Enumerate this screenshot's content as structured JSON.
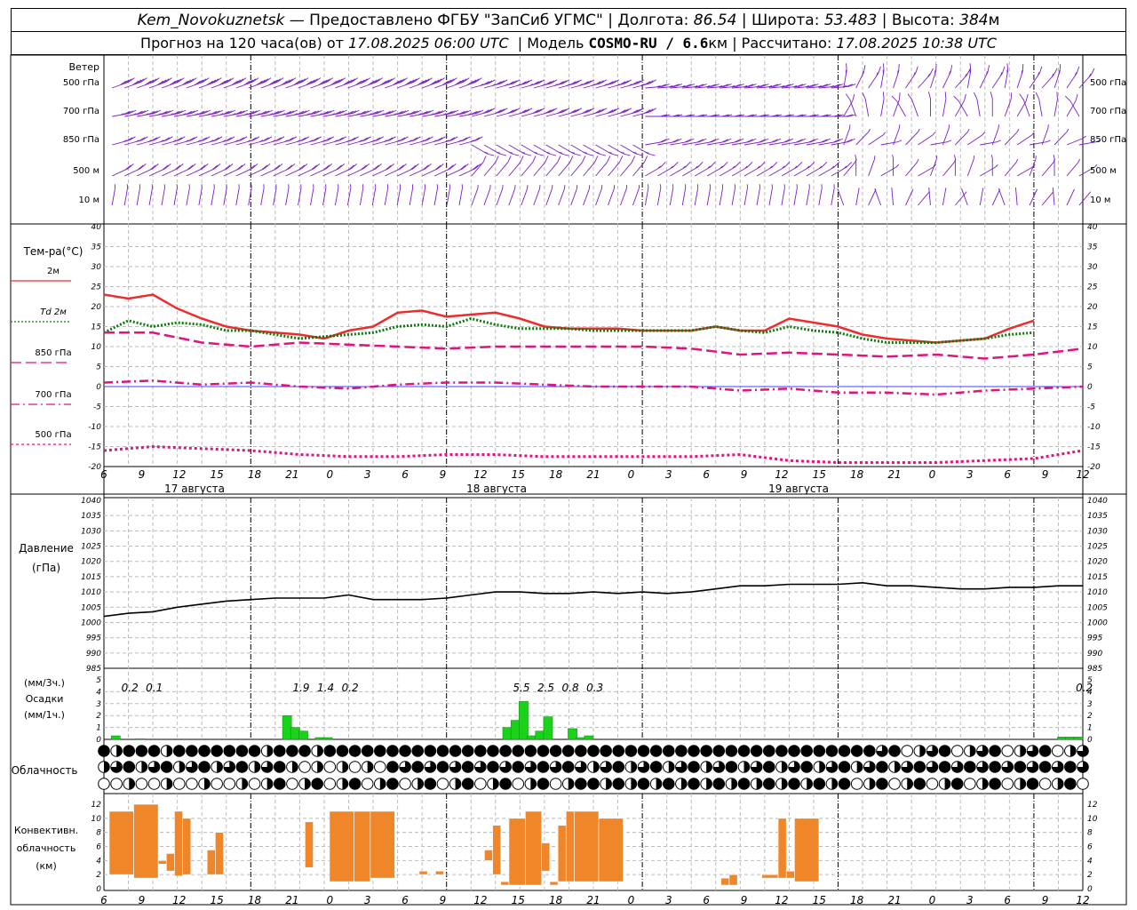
{
  "header": {
    "station": "Kem_Novokuznetsk",
    "provider": " — Предоставлено ФГБУ \"ЗапСиб УГМС\" | ",
    "lon_label": "Долгота: ",
    "lon_value": "86.54",
    "lat_label": " | Широта: ",
    "lat_value": "53.483",
    "alt_label": " | Высота: ",
    "alt_value": "384",
    "alt_unit": "м",
    "forecast_prefix": "Прогноз на 120 часа(ов) от ",
    "forecast_time": "17.08.2025 06:00 UTC",
    "model_label": "  | Модель ",
    "model_name": "COSMO-RU / 6.6",
    "model_unit": "км",
    "calc_label": " | Рассчитано: ",
    "calc_time": "17.08.2025 10:38 UTC"
  },
  "wind_panel": {
    "title": "Ветер",
    "levels": [
      "500 гПа",
      "700 гПа",
      "850 гПа",
      "500  м",
      "10   м"
    ]
  },
  "temp_panel": {
    "title": "Тем-ра(°C)",
    "legend": [
      {
        "label": "2м",
        "color": "#ee2c2c",
        "style": "solid"
      },
      {
        "label": "Td  2м",
        "color": "#0a7a0a",
        "style": "dotted"
      },
      {
        "label": "850 гПа",
        "color": "#e0147c",
        "style": "dashed"
      },
      {
        "label": "700 гПа",
        "color": "#e0147c",
        "style": "dashdot"
      },
      {
        "label": "500 гПа",
        "color": "#e0147c",
        "style": "dots"
      }
    ],
    "y_ticks": [
      "40",
      "35",
      "30",
      "25",
      "20",
      "15",
      "10",
      "5",
      "0",
      "-5",
      "-10",
      "-15",
      "-20"
    ]
  },
  "x_axis": {
    "hour_labels": [
      "6",
      "9",
      "12",
      "15",
      "18",
      "21",
      "0",
      "3",
      "6",
      "9",
      "12",
      "15",
      "18",
      "21",
      "0",
      "3",
      "6",
      "9",
      "12",
      "15",
      "18",
      "21",
      "0",
      "3",
      "6",
      "9",
      "12"
    ],
    "dates": [
      "17 августа",
      "18 августа",
      "19 августа"
    ]
  },
  "pressure_panel": {
    "title": "Давление",
    "unit": "(гПа)",
    "y_ticks": [
      "1040",
      "1035",
      "1030",
      "1025",
      "1020",
      "1015",
      "1010",
      "1005",
      "1000",
      "995",
      "990",
      "985"
    ]
  },
  "precip_panel": {
    "unit3": "(мм/3ч.)",
    "title": "Осадки",
    "unit1": "(мм/1ч.)",
    "y_ticks": [
      "5",
      "4",
      "3",
      "2",
      "1",
      "0"
    ],
    "totals": [
      {
        "x": 1,
        "text": "0.2"
      },
      {
        "x": 4,
        "text": "0.1"
      },
      {
        "x": 22,
        "text": "1.9"
      },
      {
        "x": 25,
        "text": "1.4"
      },
      {
        "x": 28,
        "text": "0.2"
      },
      {
        "x": 49,
        "text": "5.5"
      },
      {
        "x": 52,
        "text": "2.5"
      },
      {
        "x": 55,
        "text": "0.8"
      },
      {
        "x": 58,
        "text": "0.3"
      },
      {
        "x": 118,
        "text": "0.2"
      }
    ]
  },
  "cloud_panel": {
    "title": "Облачность"
  },
  "conv_panel": {
    "title1": "Конвективн.",
    "title2": "облачность",
    "unit": "(км)",
    "y_ticks": [
      "12",
      "10",
      "8",
      "6",
      "4",
      "2",
      "0"
    ]
  },
  "chart_data": {
    "type": "line",
    "x_hours_start": "2025-08-17 06:00 UTC",
    "x_step_hours": 1,
    "temperature": {
      "ylim": [
        -20,
        40
      ],
      "series": [
        {
          "name": "2м",
          "x": [
            0,
            3,
            6,
            9,
            12,
            15,
            18,
            21,
            24,
            27,
            30,
            33,
            36,
            39,
            42,
            45,
            48,
            51,
            54,
            57,
            60,
            63,
            66,
            69,
            72,
            75,
            78,
            81,
            84,
            87,
            90,
            93,
            96,
            99,
            102,
            105,
            108,
            111,
            114
          ],
          "values": [
            23,
            22,
            23,
            19.5,
            17,
            15,
            14,
            13.5,
            13,
            12,
            14,
            15,
            18.5,
            19,
            17.5,
            18,
            18.5,
            17,
            15,
            14.5,
            14.5,
            14.5,
            14,
            14,
            14,
            15,
            14,
            14,
            17,
            16,
            15,
            13,
            12,
            11.5,
            11,
            11.5,
            12,
            14.5,
            16.5
          ]
        },
        {
          "name": "Td  2м",
          "x": [
            0,
            3,
            6,
            9,
            12,
            15,
            18,
            21,
            24,
            27,
            30,
            33,
            36,
            39,
            42,
            45,
            48,
            51,
            54,
            57,
            60,
            63,
            66,
            69,
            72,
            75,
            78,
            81,
            84,
            87,
            90,
            93,
            96,
            99,
            102,
            105,
            108,
            111,
            114
          ],
          "values": [
            13.5,
            16.5,
            15,
            16,
            15.5,
            14,
            14,
            13,
            12,
            12.5,
            13,
            13.5,
            15,
            15.5,
            15,
            17,
            15.5,
            14.5,
            14.5,
            14.5,
            14,
            14,
            14,
            14,
            14,
            15,
            14,
            13.5,
            15,
            14,
            13.5,
            12,
            11,
            11,
            11,
            11.5,
            12,
            13,
            13.5
          ]
        },
        {
          "name": "850 гПа",
          "x": [
            0,
            6,
            12,
            18,
            24,
            30,
            36,
            42,
            48,
            54,
            60,
            66,
            72,
            78,
            84,
            90,
            96,
            102,
            108,
            114,
            120
          ],
          "values": [
            13.5,
            13.5,
            11,
            10,
            11,
            10.5,
            10,
            9.5,
            10,
            10,
            10,
            10,
            9.5,
            8,
            8.5,
            8,
            7.5,
            8,
            7,
            8,
            9.5
          ]
        },
        {
          "name": "700 гПа",
          "x": [
            0,
            6,
            12,
            18,
            24,
            30,
            36,
            42,
            48,
            54,
            60,
            66,
            72,
            78,
            84,
            90,
            96,
            102,
            108,
            114,
            120
          ],
          "values": [
            1,
            1.5,
            0.5,
            1,
            0,
            -0.5,
            0.5,
            1,
            1,
            0.5,
            0,
            0,
            0,
            -1,
            -0.5,
            -1.5,
            -1.5,
            -2,
            -1,
            -0.5,
            0
          ]
        },
        {
          "name": "500 гПа",
          "x": [
            0,
            6,
            12,
            18,
            24,
            30,
            36,
            42,
            48,
            54,
            60,
            66,
            72,
            78,
            84,
            90,
            96,
            102,
            108,
            114,
            120
          ],
          "values": [
            -16,
            -15,
            -15.5,
            -16,
            -17,
            -17.5,
            -17.5,
            -17,
            -17,
            -17.5,
            -17.5,
            -17.5,
            -17.5,
            -17,
            -18.5,
            -19,
            -19,
            -19,
            -18.5,
            -18,
            -16
          ]
        }
      ]
    },
    "pressure": {
      "ylim": [
        985,
        1040
      ],
      "x": [
        0,
        3,
        6,
        9,
        12,
        15,
        18,
        21,
        24,
        27,
        30,
        33,
        36,
        39,
        42,
        45,
        48,
        51,
        54,
        57,
        60,
        63,
        66,
        69,
        72,
        75,
        78,
        81,
        84,
        87,
        90,
        93,
        96,
        99,
        102,
        105,
        108,
        111,
        114,
        117,
        120
      ],
      "values": [
        1002,
        1003,
        1003.5,
        1005,
        1006,
        1007,
        1007.5,
        1008,
        1008,
        1008,
        1009,
        1007.5,
        1007.5,
        1007.5,
        1008,
        1009,
        1010,
        1010,
        1009.5,
        1009.5,
        1010,
        1009.5,
        1010,
        1009.5,
        1010,
        1011,
        1012,
        1012,
        1012.5,
        1012.5,
        1012.5,
        1013,
        1012,
        1012,
        1011.5,
        1011,
        1011,
        1011.5,
        1011.5,
        1012,
        1012
      ]
    },
    "precip_1h": {
      "ylim": [
        0,
        5
      ],
      "bars": [
        [
          1,
          0.3
        ],
        [
          4,
          0.05
        ],
        [
          22,
          2
        ],
        [
          23,
          1
        ],
        [
          24,
          0.7
        ],
        [
          26,
          0.15
        ],
        [
          27,
          0.15
        ],
        [
          49,
          1
        ],
        [
          50,
          1.6
        ],
        [
          51,
          3.2
        ],
        [
          52,
          0.3
        ],
        [
          53,
          0.7
        ],
        [
          54,
          1.9
        ],
        [
          57,
          0.9
        ],
        [
          58,
          0.15
        ],
        [
          59,
          0.3
        ],
        [
          117,
          0.2
        ],
        [
          118,
          0.2
        ],
        [
          119,
          0.2
        ]
      ]
    },
    "convective": {
      "ylim": [
        0,
        13
      ],
      "bars": [
        [
          0,
          3,
          2,
          11
        ],
        [
          3,
          6,
          1.5,
          12
        ],
        [
          6,
          7,
          3.5,
          4
        ],
        [
          7,
          8,
          2.5,
          5
        ],
        [
          8,
          9,
          1.8,
          11
        ],
        [
          9,
          10,
          2,
          10
        ],
        [
          12,
          13,
          2,
          5.5
        ],
        [
          13,
          14,
          2,
          8
        ],
        [
          24,
          25,
          3,
          9.5
        ],
        [
          27,
          30,
          1,
          11
        ],
        [
          30,
          32,
          1,
          11
        ],
        [
          32,
          35,
          1.5,
          11
        ],
        [
          38,
          39,
          2,
          2.5
        ],
        [
          40,
          41,
          2,
          2.5
        ],
        [
          46,
          47,
          4,
          5.5
        ],
        [
          47,
          48,
          2,
          9
        ],
        [
          48,
          49,
          0.5,
          1
        ],
        [
          49,
          51,
          0.5,
          10
        ],
        [
          51,
          53,
          0.5,
          11
        ],
        [
          53,
          54,
          2.5,
          6.5
        ],
        [
          54,
          55,
          0.5,
          1
        ],
        [
          55,
          56,
          1,
          9
        ],
        [
          56,
          57,
          1,
          11
        ],
        [
          57,
          60,
          1,
          11
        ],
        [
          60,
          63,
          1,
          10
        ],
        [
          70,
          71,
          0.5,
          0.5
        ],
        [
          75,
          76,
          0.5,
          1.5
        ],
        [
          76,
          77,
          0.5,
          2
        ],
        [
          80,
          82,
          1.5,
          2
        ],
        [
          82,
          83,
          1.5,
          10
        ],
        [
          83,
          84,
          1.5,
          2.5
        ],
        [
          84,
          87,
          1,
          10
        ]
      ]
    },
    "clouds": {
      "rows": 3,
      "cols": 79,
      "levels": "0=clear 1=quarter 2=half 3=three-quarter 4=overcast"
    }
  }
}
